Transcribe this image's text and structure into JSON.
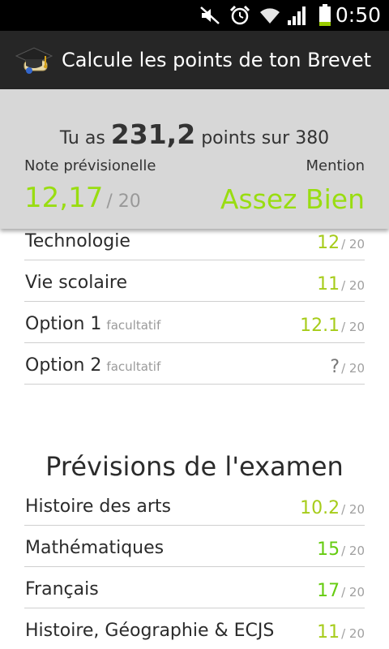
{
  "status_bar": {
    "time": "0:50",
    "icons": [
      "mute-icon",
      "alarm-icon",
      "wifi-icon",
      "signal-icon",
      "battery-icon"
    ]
  },
  "action_bar": {
    "title": "Calcule les points de ton Brevet",
    "icon": "graduation-cap-icon"
  },
  "score": {
    "prefix": "Tu as",
    "total": "231,2",
    "suffix": "points sur 380",
    "note_label": "Note prévisionelle",
    "note_value": "12,17",
    "note_max": "/ 20",
    "mention_label": "Mention",
    "mention_value": "Assez Bien"
  },
  "subjects": [
    {
      "label": "Technologie",
      "sub": "",
      "value": "12",
      "max": "/ 20"
    },
    {
      "label": "Vie scolaire",
      "sub": "",
      "value": "11",
      "max": "/ 20"
    },
    {
      "label": "Option 1",
      "sub": "facultatif",
      "value": "12.1",
      "max": "/ 20"
    },
    {
      "label": "Option 2",
      "sub": "facultatif",
      "value": "?",
      "max": "/ 20"
    }
  ],
  "exam": {
    "title": "Prévisions de l'examen",
    "items": [
      {
        "label": "Histoire des arts",
        "value": "10.2",
        "max": "/ 20"
      },
      {
        "label": "Mathématiques",
        "value": "15",
        "max": "/ 20"
      },
      {
        "label": "Français",
        "value": "17",
        "max": "/ 20"
      },
      {
        "label": "Histoire, Géographie & ECJS",
        "value": "11",
        "max": "/ 20"
      }
    ]
  },
  "colors": {
    "accent_green": "#99dd11",
    "grade_yellow_green": "#a6cc1a",
    "grade_green": "#66cc11",
    "panel_bg": "#d7d7d7",
    "action_bar_bg": "#262626"
  }
}
